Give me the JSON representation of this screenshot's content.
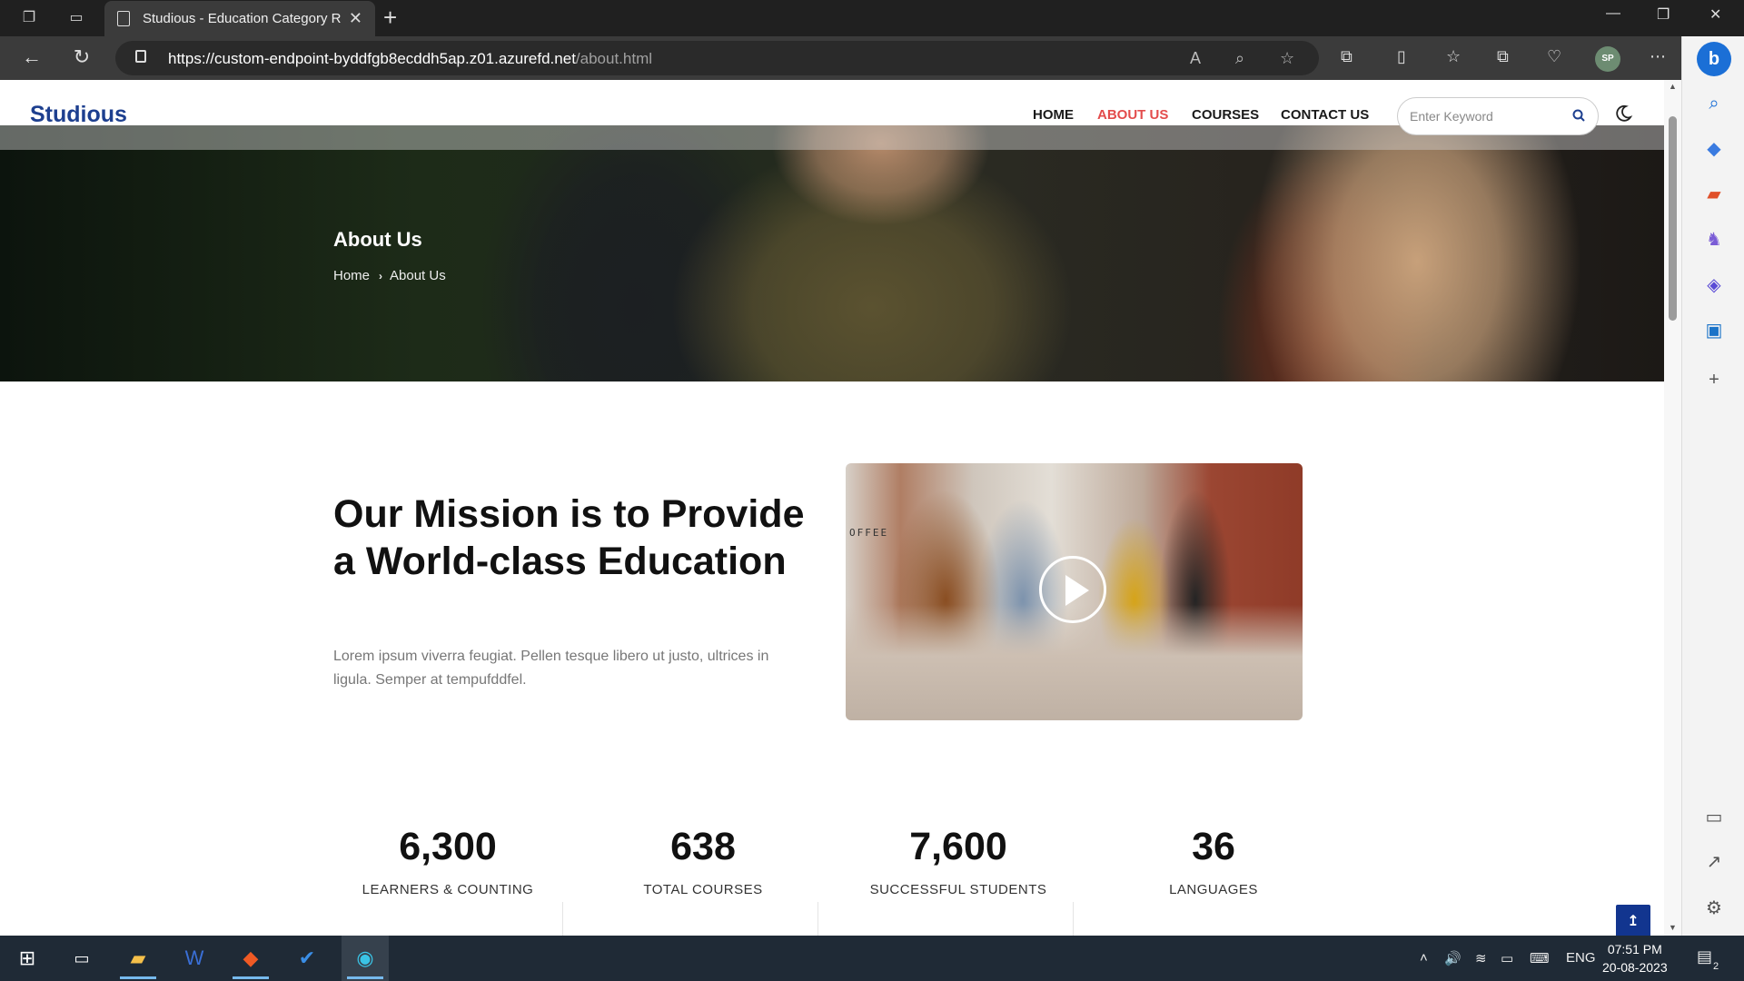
{
  "browser": {
    "tab_title": "Studious - Education Category R",
    "url_main": "https://custom-endpoint-byddfgb8ecddh5ap.z01.azurefd.net",
    "url_path": "/about.html",
    "profile_initials": "SP",
    "sidebar_icons": [
      "search-icon",
      "tag-icon",
      "briefcase-icon",
      "chess-icon",
      "copilot-icon",
      "outlook-icon",
      "add-icon",
      "split-icon",
      "external-icon",
      "settings-icon"
    ]
  },
  "site": {
    "logo": "Studious",
    "nav": [
      {
        "label": "HOME"
      },
      {
        "label": "ABOUT US"
      },
      {
        "label": "COURSES"
      },
      {
        "label": "CONTACT US"
      }
    ],
    "search_placeholder": "Enter Keyword",
    "accent_color": "#e34c4c",
    "brand_color": "#1d3f8f"
  },
  "hero": {
    "title": "About Us",
    "breadcrumb_home": "Home",
    "breadcrumb_current": "About Us"
  },
  "mission": {
    "heading": "Our Mission is to Provide a World-class Education",
    "text": "Lorem ipsum viverra feugiat. Pellen tesque libero ut justo, ultrices in ligula. Semper at tempufddfel.",
    "video_sign": "OFFEE"
  },
  "stats": [
    {
      "value": "6,300",
      "label": "LEARNERS & COUNTING"
    },
    {
      "value": "638",
      "label": "TOTAL COURSES"
    },
    {
      "value": "7,600",
      "label": "SUCCESSFUL STUDENTS"
    },
    {
      "value": "36",
      "label": "LANGUAGES"
    }
  ],
  "taskbar": {
    "time": "07:51 PM",
    "date": "20-08-2023",
    "lang": "ENG",
    "notifications": "2"
  }
}
